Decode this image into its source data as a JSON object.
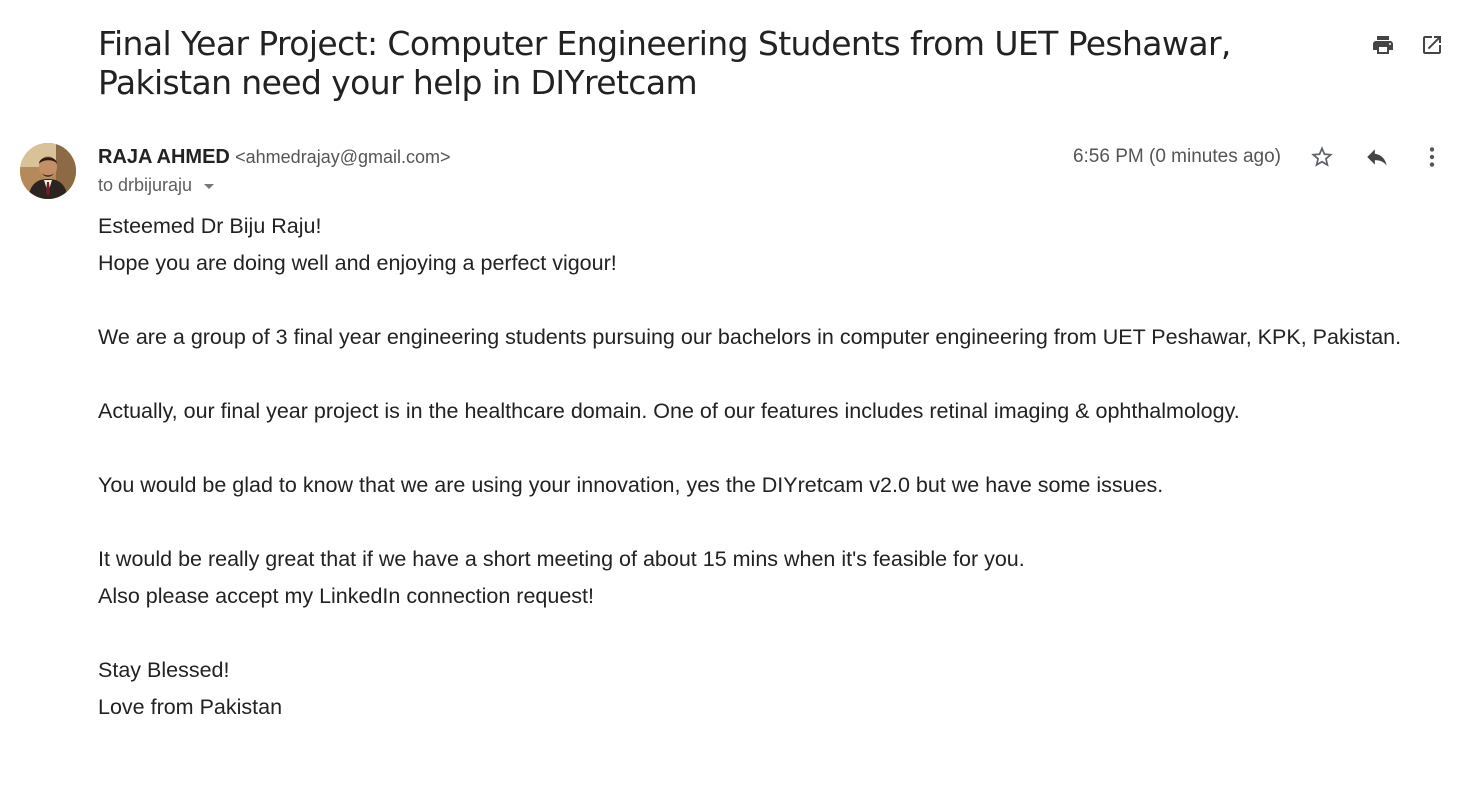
{
  "subject": "Final Year Project: Computer Engineering Students from UET Peshawar, Pakistan need your help in DIYretcam",
  "toolbar": {
    "print_icon": "printer-icon",
    "open_new_window_icon": "open-in-new-icon"
  },
  "sender": {
    "name": "RAJA AHMED",
    "email": "<ahmedrajay@gmail.com>",
    "avatar": "avatar"
  },
  "recipient": {
    "text": "to drbijuraju"
  },
  "time": "6:56 PM (0 minutes ago)",
  "actions": {
    "star_icon": "star-icon",
    "reply_icon": "reply-icon",
    "more_icon": "more-vert-icon"
  },
  "body": {
    "lines": [
      "Esteemed Dr Biju Raju!",
      "Hope you are doing well and enjoying a perfect vigour!",
      "",
      "We are a group of 3 final year engineering students pursuing our bachelors in computer engineering from UET Peshawar, KPK, Pakistan.",
      "",
      "Actually, our final year project is in the healthcare domain. One of our features includes retinal imaging & ophthalmology.",
      "",
      "You would be glad to know that we are using your innovation, yes the DIYretcam v2.0 but we have some issues.",
      "",
      "It would be really great that if we have a short meeting of about 15 mins when it's feasible for you.",
      "Also please accept my LinkedIn connection request!",
      "",
      "Stay Blessed!",
      "Love from Pakistan"
    ]
  }
}
